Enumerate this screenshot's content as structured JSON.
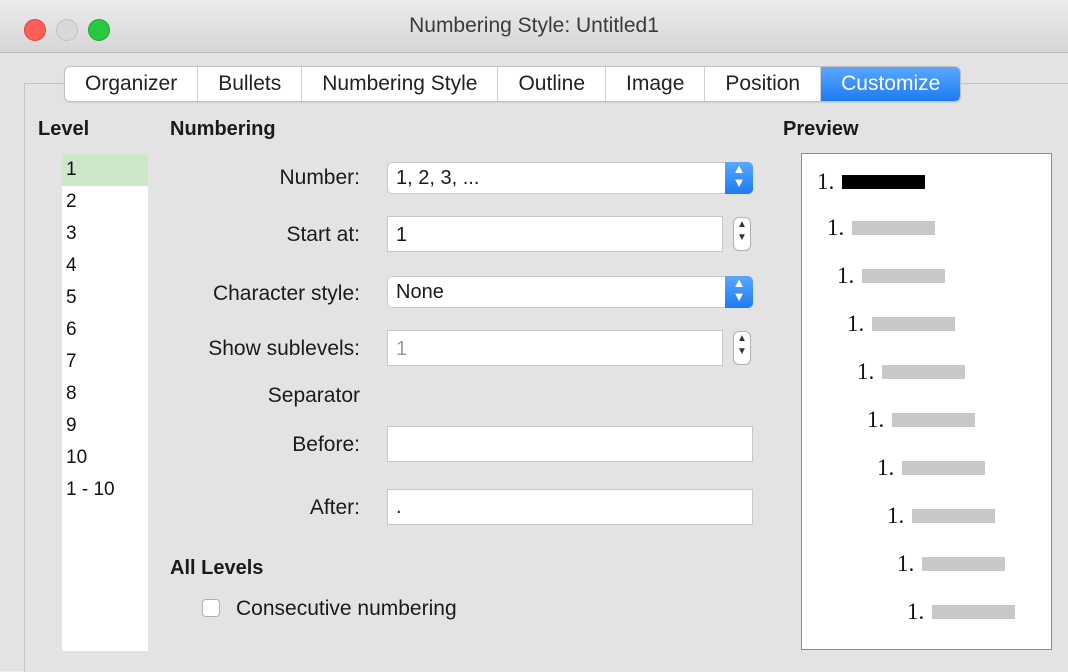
{
  "window": {
    "title": "Numbering Style: Untitled1"
  },
  "tabs": [
    {
      "label": "Organizer",
      "active": false
    },
    {
      "label": "Bullets",
      "active": false
    },
    {
      "label": "Numbering Style",
      "active": false
    },
    {
      "label": "Outline",
      "active": false
    },
    {
      "label": "Image",
      "active": false
    },
    {
      "label": "Position",
      "active": false
    },
    {
      "label": "Customize",
      "active": true
    }
  ],
  "level": {
    "heading": "Level",
    "items": [
      "1",
      "2",
      "3",
      "4",
      "5",
      "6",
      "7",
      "8",
      "9",
      "10",
      "1 - 10"
    ],
    "selected": "1"
  },
  "numbering": {
    "heading": "Numbering",
    "number_label": "Number:",
    "number_value": "1, 2, 3, ...",
    "start_label": "Start at:",
    "start_value": "1",
    "charstyle_label": "Character style:",
    "charstyle_value": "None",
    "sublevels_label": "Show sublevels:",
    "sublevels_value": "1",
    "separator_label": "Separator",
    "before_label": "Before:",
    "before_value": "",
    "after_label": "After:",
    "after_value": "."
  },
  "all_levels": {
    "heading": "All Levels",
    "consecutive_label": "Consecutive numbering",
    "consecutive_checked": false
  },
  "preview": {
    "heading": "Preview",
    "items": [
      "1.",
      "1.",
      "1.",
      "1.",
      "1.",
      "1.",
      "1.",
      "1.",
      "1.",
      "1."
    ]
  },
  "colors": {
    "accent": "#1d7bf2",
    "selection": "#cfe7c9"
  }
}
